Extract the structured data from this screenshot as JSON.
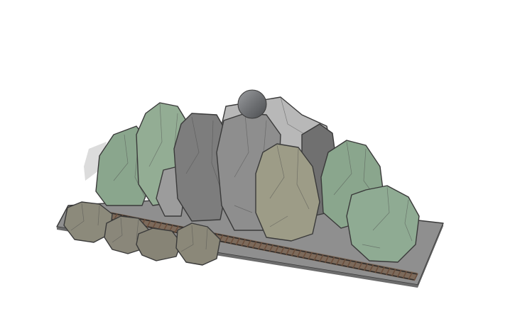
{
  "scene": {
    "description_visible_text": "",
    "colors": {
      "background": "#ffffff",
      "baseplate_top": "#8e8e8e",
      "baseplate_side": "#6f6f6f",
      "shadow": "#d9d9d9",
      "rock_green": "#8fa98f",
      "rock_green_dark": "#6f8a72",
      "rock_grey": "#8b8b8b",
      "rock_grey_dark": "#6a6a6a",
      "rock_light_grey": "#b3b3b3",
      "rock_olive": "#9c9b86",
      "boulder": "#8d8a7c",
      "sphere": "#6d6f72",
      "track_rail": "#3b3734",
      "track_tie": "#7a5a45"
    },
    "objects": [
      "baseplate",
      "railroad-track",
      "mountain-rocks",
      "foreground-boulders",
      "sphere"
    ]
  }
}
